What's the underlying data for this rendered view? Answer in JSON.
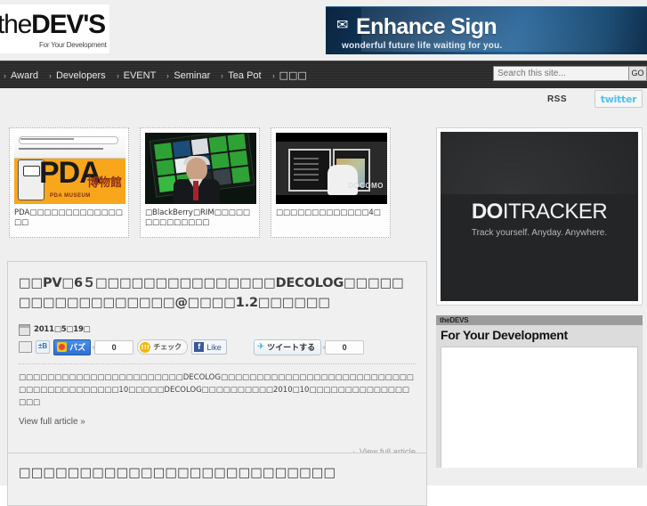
{
  "site": {
    "logo_text_the": "the",
    "logo_text_devs": "DEV'S",
    "logo_tagline": "For Your Development"
  },
  "banner": {
    "icon": "mail-stamp-icon",
    "title": "Enhance Sign",
    "subtitle": "wonderful future life waiting for you."
  },
  "nav": {
    "arrow": "›",
    "items": [
      {
        "label": "Award"
      },
      {
        "label": "Developers"
      },
      {
        "label": "EVENT"
      },
      {
        "label": "Seminar"
      },
      {
        "label": "Tea Pot"
      },
      {
        "label": "□□□"
      }
    ]
  },
  "search": {
    "placeholder": "Search this site...",
    "value": "",
    "go_label": "GO"
  },
  "social": {
    "rss_label": "RSS",
    "twitter_label": "twitter"
  },
  "thumbnails": [
    {
      "caption": "PDA□□□□□□□□□□□□□□□",
      "image_alt": "pda-museum-thumbnail",
      "art": {
        "headline": "PDA",
        "subline": "PDA MUSEUM",
        "jp_mark": "博物館"
      }
    },
    {
      "caption": "□BlackBerry□RIM□□□□□□□□□□□□□□",
      "image_alt": "blackberry-playbook-presentation-thumbnail"
    },
    {
      "caption": "□□□□□□□□□□□□□4□",
      "image_alt": "dual-screen-ereader-thumbnail",
      "art": {
        "brand": "DOCOMO"
      }
    }
  ],
  "promo": {
    "logo_do": "DO",
    "logo_itracker": "ITRACKER",
    "tagline": "Track yourself. Anyday. Anywhere.",
    "alt": "doitracker-banner"
  },
  "widget": {
    "eyebrow": "theDEVS",
    "title": "For Your Development"
  },
  "article": {
    "title": "□□PV□6５□□□□□□□□□□□□□□□DECOLOG□□□□□□□□□□□□□□□□□□@□□□□1.2□□□□□□",
    "date": "2011□5□19□",
    "share": {
      "folder_icon": "folder-icon",
      "hatena_label": "±B",
      "buzz_label": "バズ",
      "buzz_count": "0",
      "check_label": "チェック",
      "like_label": "Like",
      "like_icon": "f",
      "tweet_label": "ツイートする",
      "tweet_count": "0",
      "tweet_icon": "🐦"
    },
    "excerpt": "□□□□□□□□□□□□□□□□□□□□□□□DECOLOG□□□□□□□□□□□□□□□□□□□□□□□□□□□□□□□□□□□□□□□□□10□□□□□DECOLOG□□□□□□□□□□2010□10□□□□□□□□□□□□□□□□□",
    "view_full": "View full article »",
    "foot_arrow": "›",
    "foot_link": "View full article\n& Comment"
  },
  "article2": {
    "title": "□□□□□□□□□□□□□□□□□□□□□□□□□□"
  },
  "colors": {
    "nav_bg": "#2b2b2b",
    "page_bg": "#efefef",
    "banner_blue": "#1f5f96",
    "promo_dark": "#232527",
    "twitter_blue": "#4dc4f2",
    "facebook_blue": "#3b5998"
  }
}
